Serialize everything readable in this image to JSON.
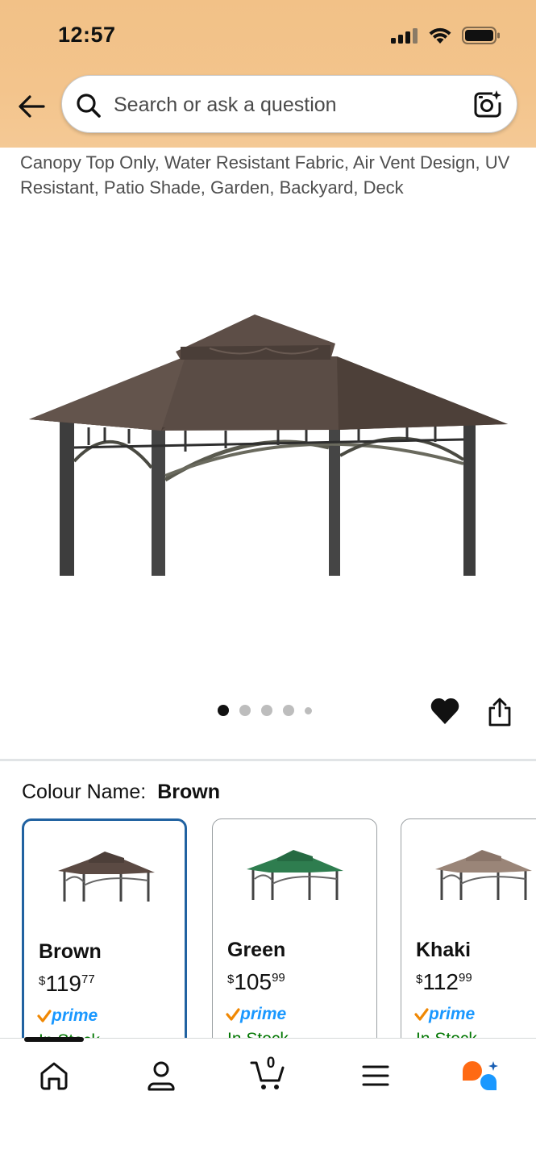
{
  "status_bar": {
    "time": "12:57"
  },
  "search": {
    "placeholder": "Search or ask a question"
  },
  "product": {
    "title_visible": "Canopy Top Only, Water Resistant Fabric, Air Vent Design, UV Resistant, Patio Shade, Garden, Backyard, Deck",
    "image_icon": "gazebo-canopy-image",
    "carousel": {
      "total": 5,
      "active_index": 0
    }
  },
  "actions": {
    "wishlist_icon": "heart-icon",
    "share_icon": "share-icon"
  },
  "colour": {
    "label": "Colour Name:",
    "selected": "Brown",
    "options": [
      {
        "name": "Brown",
        "currency": "$",
        "price_main": "119",
        "price_fraction": "77",
        "prime": "prime",
        "stock": "In Stock",
        "color": "#5b4a43"
      },
      {
        "name": "Green",
        "currency": "$",
        "price_main": "105",
        "price_fraction": "99",
        "prime": "prime",
        "stock": "In Stock",
        "color": "#2e7d4f"
      },
      {
        "name": "Khaki",
        "currency": "$",
        "price_main": "112",
        "price_fraction": "99",
        "prime": "prime",
        "stock": "In Stock",
        "color": "#9a8578"
      }
    ]
  },
  "bottom_nav": {
    "items": [
      "home-icon",
      "account-icon",
      "cart-icon",
      "menu-icon",
      "rufus-assistant-icon"
    ],
    "cart_count": "0"
  },
  "colors": {
    "accent_blue": "#2162a1",
    "prime_blue": "#1a98ff",
    "prime_check": "#f08804",
    "stock_green": "#007600"
  }
}
